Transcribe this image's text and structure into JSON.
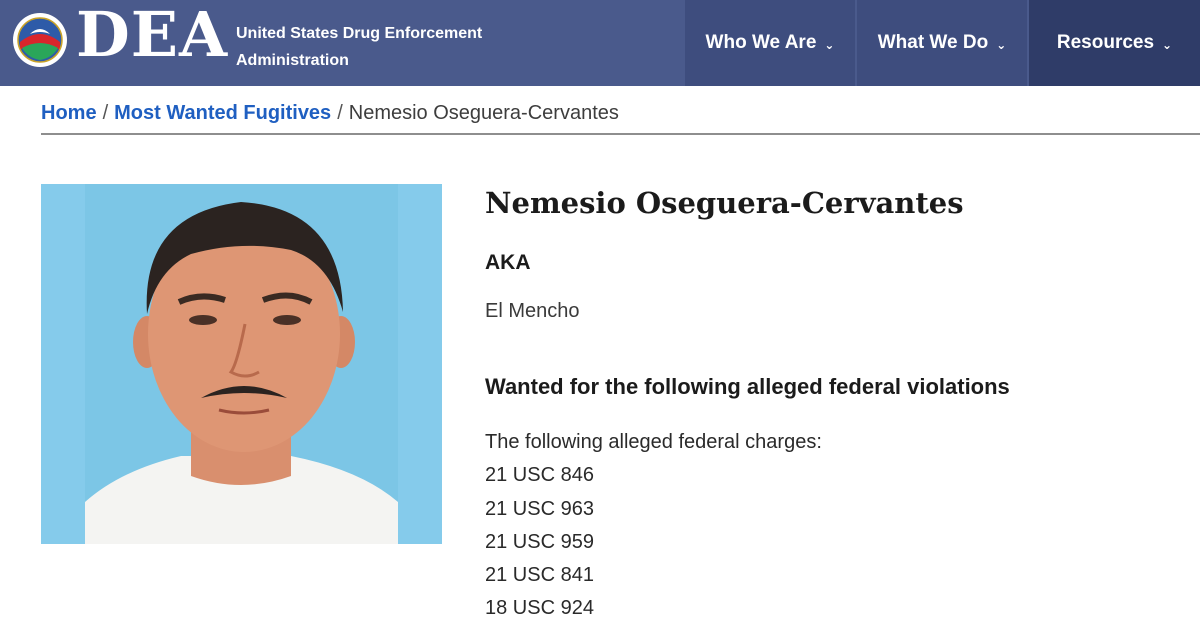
{
  "header": {
    "wordmark": "DEA",
    "agency_line1": "United States Drug Enforcement",
    "agency_line2": "Administration",
    "colors": {
      "bar": "#4a5a8c",
      "nav_dark": "#2f3c68"
    },
    "nav": [
      {
        "label": "Who We Are",
        "icon": "chevron-down-icon"
      },
      {
        "label": "What We Do",
        "icon": "chevron-down-icon"
      },
      {
        "label": "Resources",
        "icon": "chevron-down-icon"
      }
    ]
  },
  "breadcrumb": {
    "home": "Home",
    "section": "Most Wanted Fugitives",
    "current": "Nemesio Oseguera-Cervantes",
    "separator": "/"
  },
  "fugitive": {
    "name": "Nemesio Oseguera-Cervantes",
    "aka_heading": "AKA",
    "aka": "El Mencho",
    "violations_heading": "Wanted for the following alleged federal violations",
    "charges_intro": "The following alleged federal charges:",
    "charges": [
      "21 USC 846",
      "21 USC 963",
      "21 USC 959",
      "21 USC 841",
      "18 USC 924"
    ]
  }
}
